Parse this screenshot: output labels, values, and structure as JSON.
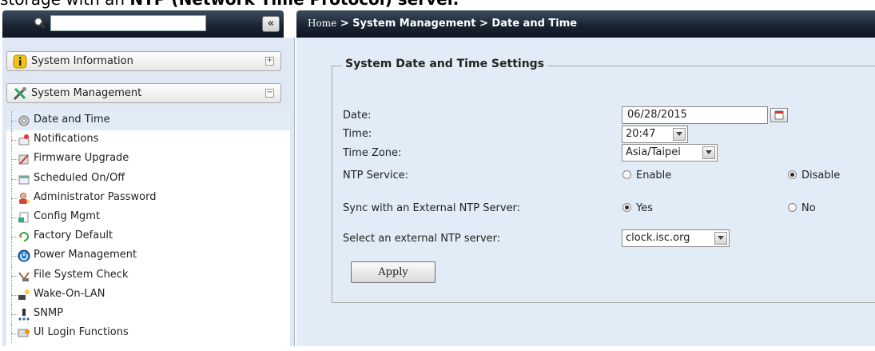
{
  "caption": {
    "pre": "storage with an ",
    "bold": "NTP (Network Time Protocol) server."
  },
  "left": {
    "collapse_glyph": "«",
    "accordion": [
      {
        "label": "System Information",
        "toggle": "+"
      },
      {
        "label": "System Management",
        "toggle": "−"
      }
    ],
    "items": [
      {
        "label": "Date and Time",
        "icon": "gear-icon"
      },
      {
        "label": "Notifications",
        "icon": "notification-icon"
      },
      {
        "label": "Firmware Upgrade",
        "icon": "firmware-icon"
      },
      {
        "label": "Scheduled On/Off",
        "icon": "schedule-icon"
      },
      {
        "label": "Administrator Password",
        "icon": "admin-icon"
      },
      {
        "label": "Config Mgmt",
        "icon": "config-icon"
      },
      {
        "label": "Factory Default",
        "icon": "factory-default-icon"
      },
      {
        "label": "Power Management",
        "icon": "power-icon"
      },
      {
        "label": "File System Check",
        "icon": "filesystem-check-icon"
      },
      {
        "label": "Wake-On-LAN",
        "icon": "wake-on-lan-icon"
      },
      {
        "label": "SNMP",
        "icon": "snmp-icon"
      },
      {
        "label": "UI Login Functions",
        "icon": "login-icon"
      }
    ]
  },
  "breadcrumb": {
    "home": "Home",
    "rest": " > System Management > Date and Time"
  },
  "form": {
    "legend": "System Date and Time Settings",
    "date_label": "Date:",
    "date_value": "06/28/2015",
    "time_label": "Time:",
    "time_value": "20:47",
    "timezone_label": "Time Zone:",
    "timezone_value": "Asia/Taipei",
    "ntp_label": "NTP Service:",
    "ntp_enable": "Enable",
    "ntp_disable": "Disable",
    "ntp_selected": "Disable",
    "sync_label": "Sync with an External NTP Server:",
    "sync_yes": "Yes",
    "sync_no": "No",
    "sync_selected": "Yes",
    "server_label": "Select an external NTP server:",
    "server_value": "clock.isc.org",
    "apply_label": "Apply"
  },
  "colors": {
    "header_dark": "#1a2533",
    "panel_bg": "#e2ecf7",
    "selected_bg": "#e2ecf7"
  }
}
